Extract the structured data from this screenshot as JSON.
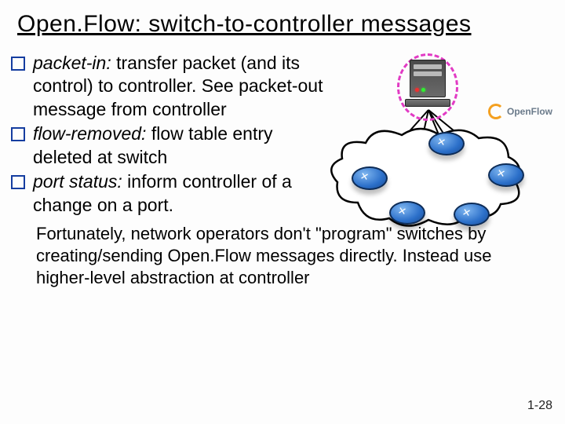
{
  "title": "Open.Flow: switch-to-controller messages",
  "bullets": [
    {
      "term": "packet-in:",
      "rest": " transfer packet (and its control) to controller.  See packet-out message from controller"
    },
    {
      "term": "flow-removed:",
      "rest": " flow table entry deleted at switch"
    },
    {
      "term": "port status:",
      "rest": " inform controller of a change on a port."
    }
  ],
  "logo": {
    "text": "OpenFlow"
  },
  "footnote": "Fortunately, network operators don't \"program\" switches by creating/sending Open.Flow messages directly.  Instead use higher-level abstraction at controller",
  "pagenum": "1-28"
}
